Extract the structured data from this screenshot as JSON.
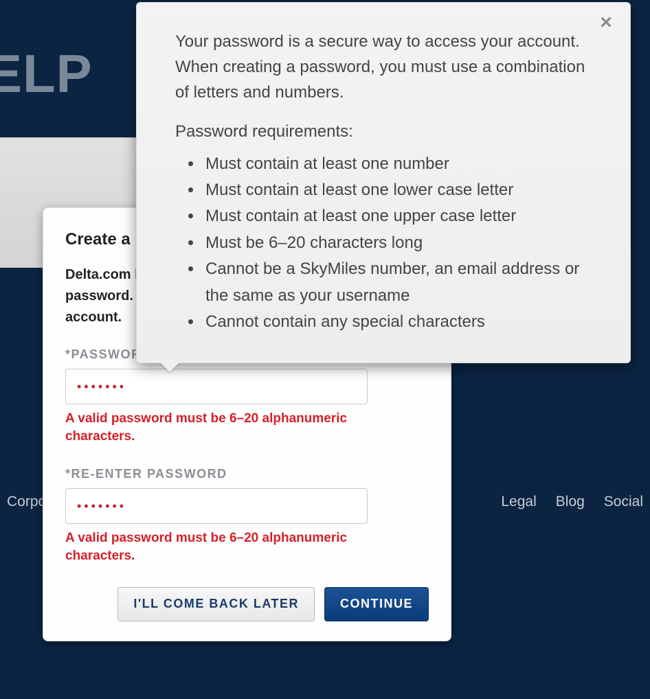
{
  "page": {
    "title_fragment": "ELP"
  },
  "footer": {
    "left": "Corpor",
    "legal": "Legal",
    "blog": "Blog",
    "social": "Social"
  },
  "modal": {
    "heading": "Create a Password",
    "intro": "Delta.com has updated how you manage your password. Please create a new password for your account.",
    "password": {
      "label": "*PASSWORD",
      "value": "•••••••",
      "error": "A valid password must be 6–20 alphanumeric characters."
    },
    "reenter": {
      "label": "*RE-ENTER PASSWORD",
      "value": "•••••••",
      "error": "A valid password must be 6–20 alphanumeric characters."
    },
    "buttons": {
      "later": "I'LL COME BACK LATER",
      "continue": "CONTINUE"
    }
  },
  "tooltip": {
    "description": "Your password is a secure way to access your account. When creating a password, you must use a combination of letters and numbers.",
    "subheading": "Password requirements:",
    "requirements": [
      "Must contain at least one number",
      "Must contain at least one lower case letter",
      "Must contain at least one upper case letter",
      "Must be 6–20 characters long",
      "Cannot be a SkyMiles number, an email address or the same as your username",
      "Cannot contain any special characters"
    ]
  }
}
